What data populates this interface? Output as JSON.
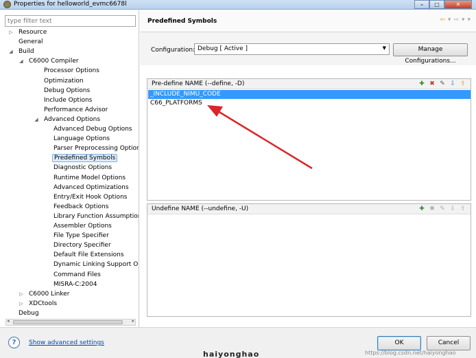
{
  "window": {
    "title": "Properties for helloworld_evmc6678l"
  },
  "filter": {
    "placeholder": "type filter text"
  },
  "tree": [
    {
      "label": "Resource",
      "twisty": "▷",
      "level": 0,
      "selected": false
    },
    {
      "label": "General",
      "twisty": "",
      "level": 0,
      "selected": false
    },
    {
      "label": "Build",
      "twisty": "◢",
      "level": 0,
      "selected": false
    },
    {
      "label": "C6000 Compiler",
      "twisty": "◢",
      "level": 1,
      "selected": false
    },
    {
      "label": "Processor Options",
      "twisty": "",
      "level": 2,
      "selected": false
    },
    {
      "label": "Optimization",
      "twisty": "",
      "level": 2,
      "selected": false
    },
    {
      "label": "Debug Options",
      "twisty": "",
      "level": 2,
      "selected": false
    },
    {
      "label": "Include Options",
      "twisty": "",
      "level": 2,
      "selected": false
    },
    {
      "label": "Performance Advisor",
      "twisty": "",
      "level": 2,
      "selected": false
    },
    {
      "label": "Advanced Options",
      "twisty": "◢",
      "level": 2,
      "selected": false
    },
    {
      "label": "Advanced Debug Options",
      "twisty": "",
      "level": 3,
      "selected": false
    },
    {
      "label": "Language Options",
      "twisty": "",
      "level": 3,
      "selected": false
    },
    {
      "label": "Parser Preprocessing Options",
      "twisty": "",
      "level": 3,
      "selected": false
    },
    {
      "label": "Predefined Symbols",
      "twisty": "",
      "level": 3,
      "selected": true
    },
    {
      "label": "Diagnostic Options",
      "twisty": "",
      "level": 3,
      "selected": false
    },
    {
      "label": "Runtime Model Options",
      "twisty": "",
      "level": 3,
      "selected": false
    },
    {
      "label": "Advanced Optimizations",
      "twisty": "",
      "level": 3,
      "selected": false
    },
    {
      "label": "Entry/Exit Hook Options",
      "twisty": "",
      "level": 3,
      "selected": false
    },
    {
      "label": "Feedback Options",
      "twisty": "",
      "level": 3,
      "selected": false
    },
    {
      "label": "Library Function Assumptions",
      "twisty": "",
      "level": 3,
      "selected": false
    },
    {
      "label": "Assembler Options",
      "twisty": "",
      "level": 3,
      "selected": false
    },
    {
      "label": "File Type Specifier",
      "twisty": "",
      "level": 3,
      "selected": false
    },
    {
      "label": "Directory Specifier",
      "twisty": "",
      "level": 3,
      "selected": false
    },
    {
      "label": "Default File Extensions",
      "twisty": "",
      "level": 3,
      "selected": false
    },
    {
      "label": "Dynamic Linking Support Option",
      "twisty": "",
      "level": 3,
      "selected": false
    },
    {
      "label": "Command Files",
      "twisty": "",
      "level": 3,
      "selected": false
    },
    {
      "label": "MISRA-C:2004",
      "twisty": "",
      "level": 3,
      "selected": false
    },
    {
      "label": "C6000 Linker",
      "twisty": "▷",
      "level": 1,
      "selected": false
    },
    {
      "label": "XDCtools",
      "twisty": "▷",
      "level": 1,
      "selected": false
    },
    {
      "label": "Debug",
      "twisty": "",
      "level": 0,
      "selected": false
    }
  ],
  "page": {
    "title": "Predefined Symbols"
  },
  "config": {
    "label": "Configuration:",
    "value": "Debug  [ Active ]",
    "manage_label": "Manage Configurations..."
  },
  "predefine": {
    "title": "Pre-define NAME (--define, -D)",
    "items": [
      {
        "name": "_INCLUDE_NIMU_CODE",
        "selected": true
      },
      {
        "name": "C66_PLATFORMS",
        "selected": false
      }
    ]
  },
  "undefine": {
    "title": "Undefine NAME (--undefine, -U)",
    "items": []
  },
  "footer": {
    "help_glyph": "?",
    "advanced_link": "Show advanced settings",
    "ok_label": "OK",
    "cancel_label": "Cancel"
  },
  "watermark": {
    "text": "haiyonghao",
    "url": "https://blog.csdn.net/haiyonghao"
  },
  "colors": {
    "selection": "#3399ff",
    "tree_selection": "#dcebfc",
    "annotation_arrow": "#d9262a"
  }
}
